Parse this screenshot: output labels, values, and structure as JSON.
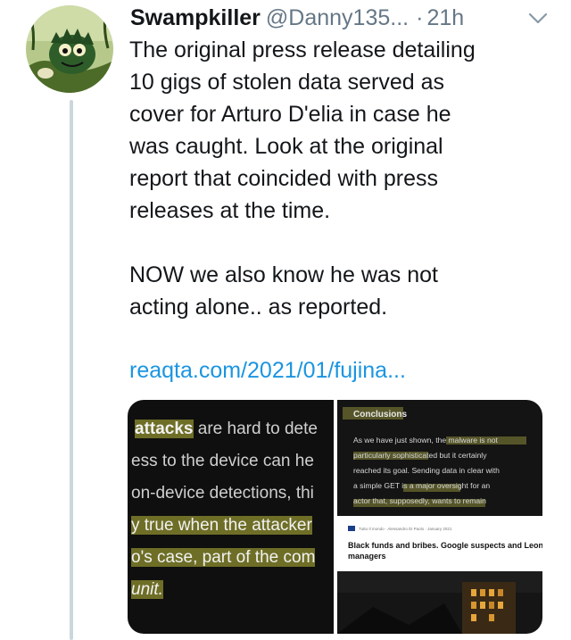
{
  "tweet": {
    "display_name": "Swampkiller",
    "handle": "@Danny135...",
    "separator": "·",
    "time": "21h",
    "text_p1": "The original press release detailing\n10 gigs of stolen data served as\ncover for Arturo D'elia in case he\nwas caught. Look at the original\nreport that coincided with press\nreleases at the time.",
    "text_p2": "NOW we also know he was not\nacting alone.. as reported.",
    "link": "reaqta.com/2021/01/fujina..."
  },
  "media": {
    "left_lines": [
      {
        "pre": "",
        "hl": "attacks",
        "post": " are hard to dete"
      },
      {
        "pre": "",
        "hl": "",
        "post": "ess to the device can he"
      },
      {
        "pre": "",
        "hl": "",
        "post": "on-device detections, thi"
      },
      {
        "pre": "",
        "hl": "y true when the attacker",
        "post": ""
      },
      {
        "pre": "",
        "hl": "o's case, part of the com",
        "post": ""
      },
      {
        "pre": "",
        "hl": "unit.",
        "post": ""
      }
    ],
    "conclusions_title": "Conclusions",
    "conclusions_lines": [
      "As we have just shown, the malware is not",
      "particularly sophisticated but it certainly",
      "reached its goal. Sending data in clear with",
      "a simple GET is a major oversight for an",
      "actor that, supposedly, wants to remain"
    ],
    "article_meta": "Tutto Il mondo · Alessandro Di Paolo · January 2021",
    "article_headline": "Black funds and bribes. Google suspects and Leonardo's managers"
  },
  "colors": {
    "link": "#1b95e0",
    "secondary_text": "#657786",
    "thread_line": "#ccd6dd"
  },
  "icons": [
    "avatar-image",
    "chevron-down-icon"
  ]
}
